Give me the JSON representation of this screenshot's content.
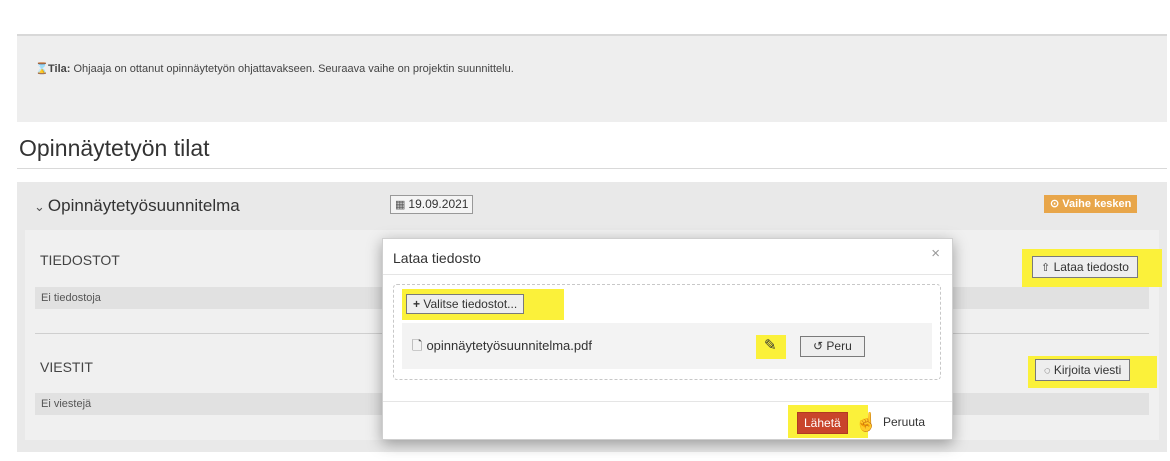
{
  "status": {
    "label": "Tila:",
    "text": " Ohjaaja on ottanut opinnäytetyön ohjattavakseen. Seuraava vaihe on projektin suunnittelu."
  },
  "section_title": "Opinnäytetyön tilat",
  "phase": {
    "title": "Opinnäytetyösuunnitelma",
    "date": "19.09.2021",
    "badge": "⊙ Vaihe kesken"
  },
  "files": {
    "title": "TIEDOSTOT",
    "empty": "Ei tiedostoja",
    "upload_button": "Lataa tiedosto"
  },
  "messages": {
    "title": "VIESTIT",
    "empty": "Ei viestejä",
    "write_button": "Kirjoita viesti"
  },
  "modal": {
    "title": "Lataa tiedosto",
    "close": "×",
    "choose_button": "Valitse tiedostot...",
    "file_name": "opinnäytetyösuunnitelma.pdf",
    "cancel_file": "Peru",
    "send": "Lähetä",
    "cancel": "Peruuta"
  },
  "colors": {
    "highlight": "#fbf13a",
    "badge": "#e8a64a",
    "send": "#c9452b"
  }
}
